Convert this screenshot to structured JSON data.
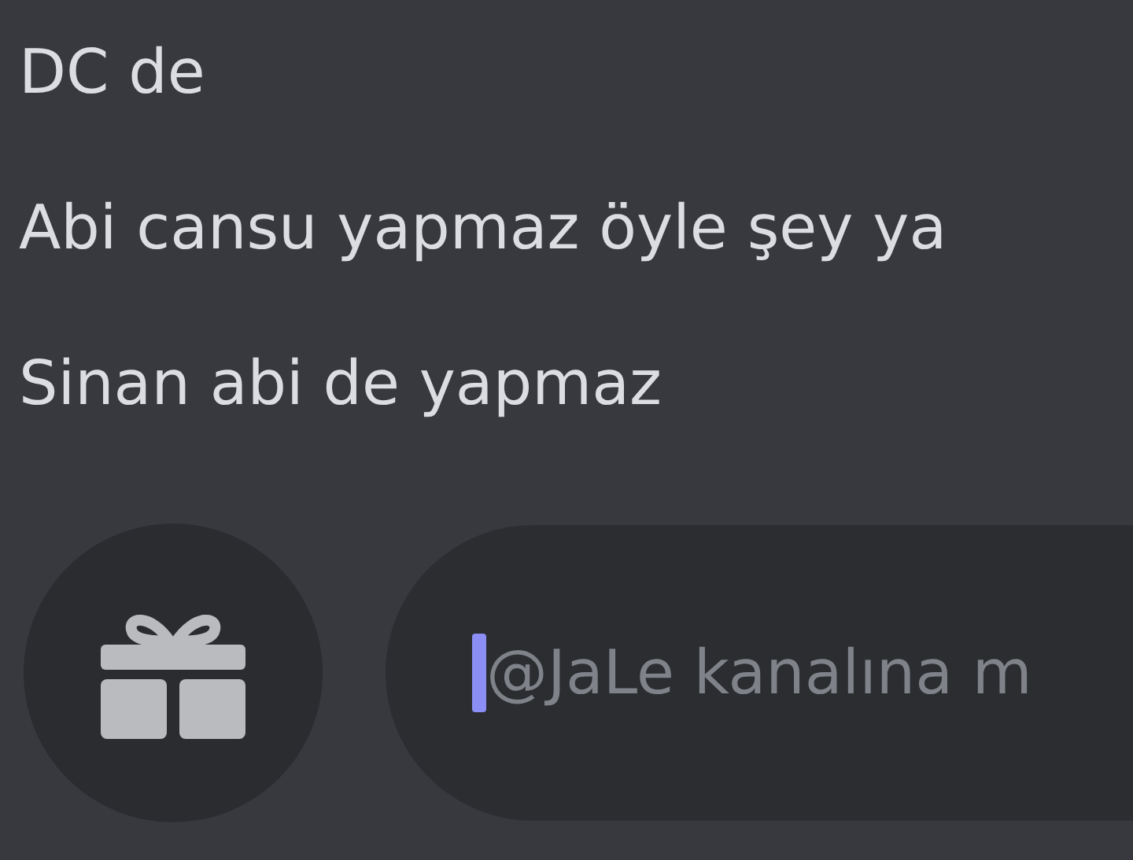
{
  "messages": [
    {
      "text": "DC de"
    },
    {
      "text": "Abi cansu yapmaz öyle şey ya"
    },
    {
      "text": "Sinan abi de yapmaz"
    }
  ],
  "composer": {
    "placeholder": "@JaLe kanalına m"
  }
}
